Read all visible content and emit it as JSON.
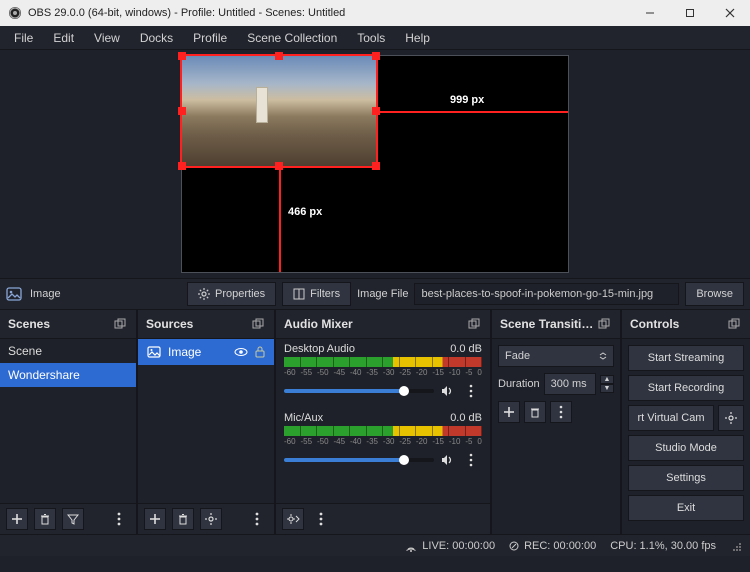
{
  "titlebar": {
    "title": "OBS 29.0.0 (64-bit, windows) - Profile: Untitled - Scenes: Untitled"
  },
  "menu": [
    "File",
    "Edit",
    "View",
    "Docks",
    "Profile",
    "Scene Collection",
    "Tools",
    "Help"
  ],
  "preview": {
    "width_label": "999 px",
    "height_label": "466 px"
  },
  "source_toolbar": {
    "selected_label": "Image",
    "properties_btn": "Properties",
    "filters_btn": "Filters",
    "field_label": "Image File",
    "field_value": "best-places-to-spoof-in-pokemon-go-15-min.jpg",
    "browse_btn": "Browse"
  },
  "scenes": {
    "title": "Scenes",
    "items": [
      "Scene",
      "Wondershare"
    ]
  },
  "sources": {
    "title": "Sources",
    "items": [
      {
        "label": "Image"
      }
    ]
  },
  "mixer": {
    "title": "Audio Mixer",
    "channels": [
      {
        "name": "Desktop Audio",
        "level": "0.0 dB",
        "ticks": [
          "-60",
          "-55",
          "-50",
          "-45",
          "-40",
          "-35",
          "-30",
          "-25",
          "-20",
          "-15",
          "-10",
          "-5",
          "0"
        ]
      },
      {
        "name": "Mic/Aux",
        "level": "0.0 dB",
        "ticks": [
          "-60",
          "-55",
          "-50",
          "-45",
          "-40",
          "-35",
          "-30",
          "-25",
          "-20",
          "-15",
          "-10",
          "-5",
          "0"
        ]
      }
    ]
  },
  "transitions": {
    "title": "Scene Transiti…",
    "selected": "Fade",
    "duration_label": "Duration",
    "duration_value": "300 ms"
  },
  "controls": {
    "title": "Controls",
    "start_streaming": "Start Streaming",
    "start_recording": "Start Recording",
    "virtual_cam": "rt Virtual Cam",
    "studio_mode": "Studio Mode",
    "settings": "Settings",
    "exit": "Exit"
  },
  "status": {
    "live": "LIVE: 00:00:00",
    "rec": "REC: 00:00:00",
    "cpu": "CPU: 1.1%, 30.00 fps"
  }
}
